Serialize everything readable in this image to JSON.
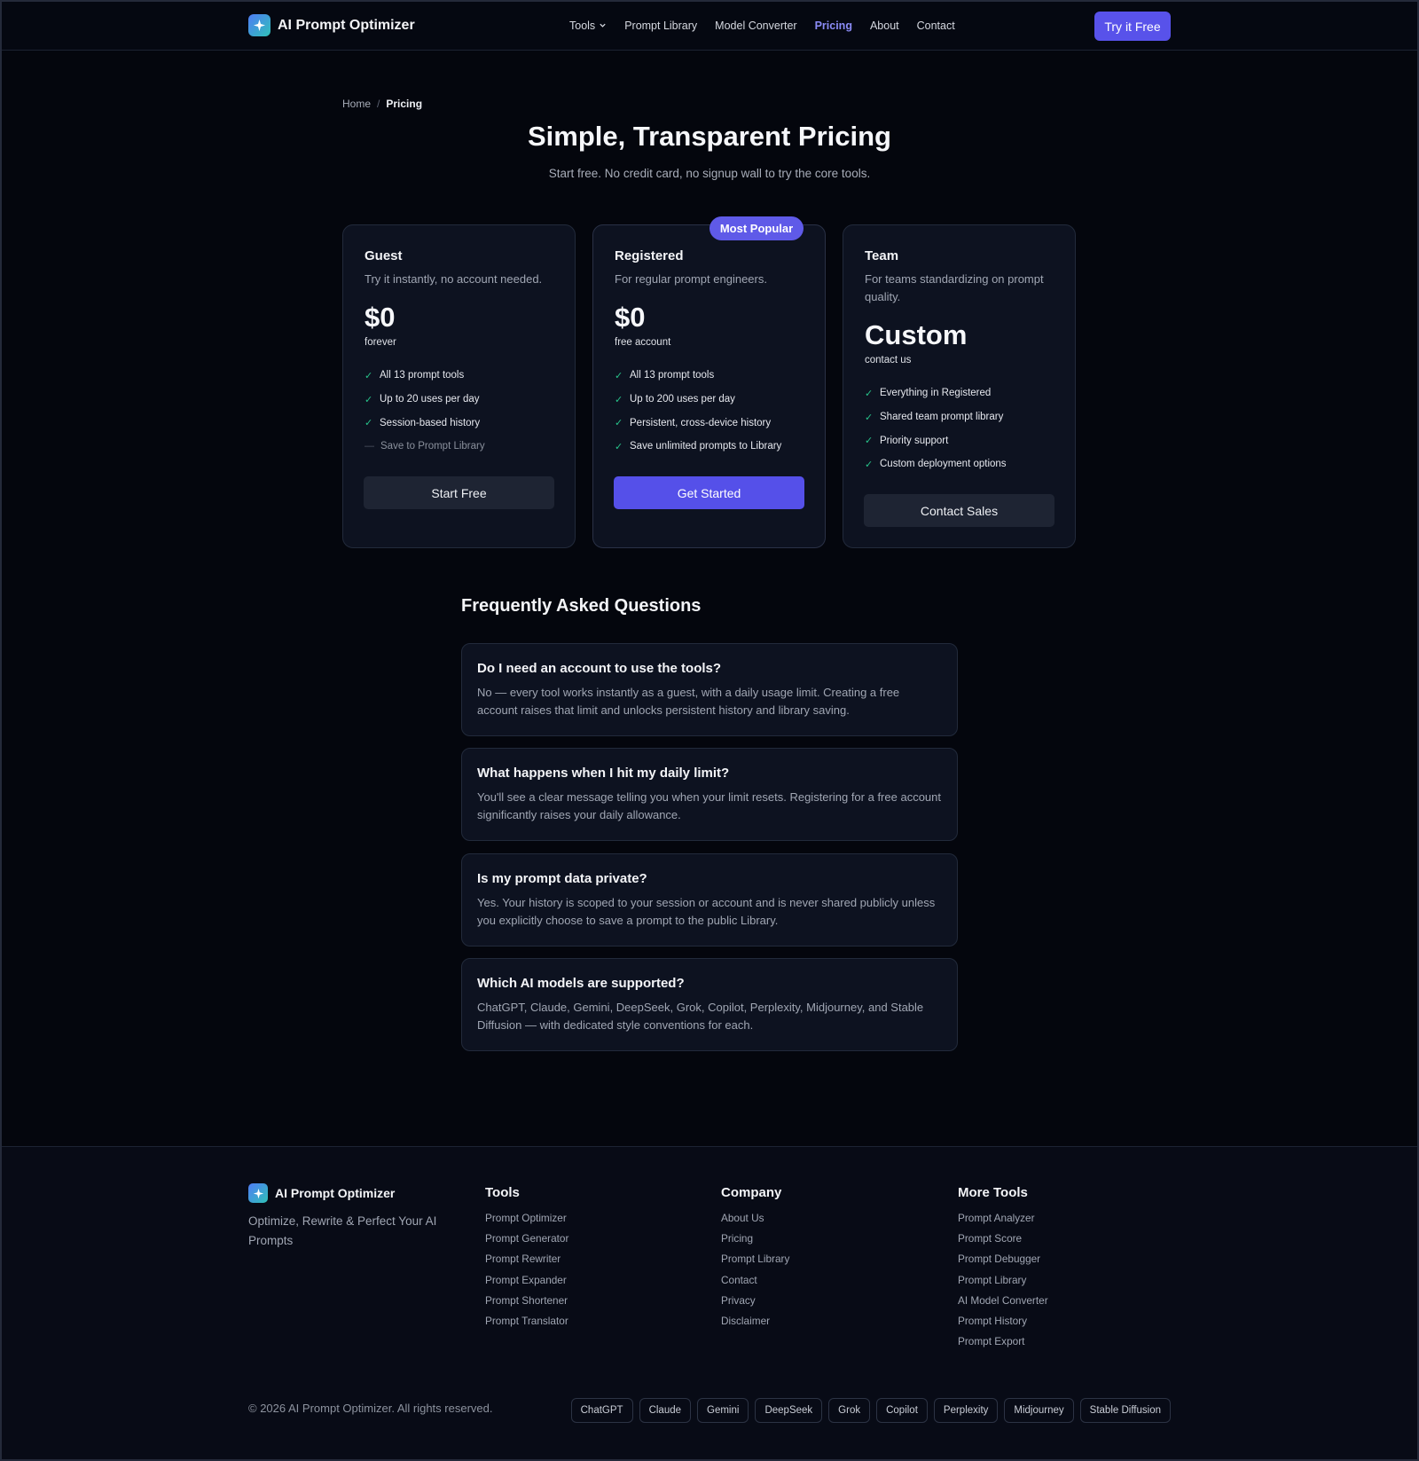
{
  "nav": {
    "brand": "AI Prompt Optimizer",
    "links": [
      {
        "label": "Tools",
        "dropdown": true,
        "active": false
      },
      {
        "label": "Prompt Library",
        "active": false
      },
      {
        "label": "Model Converter",
        "active": false
      },
      {
        "label": "Pricing",
        "active": true
      },
      {
        "label": "About",
        "active": false
      },
      {
        "label": "Contact",
        "active": false
      }
    ],
    "cta": "Try it Free",
    "accent_color": "#5852ea"
  },
  "breadcrumb": {
    "home": "Home",
    "separator": "/",
    "current": "Pricing"
  },
  "header": {
    "title": "Simple, Transparent Pricing",
    "subtitle": "Start free. No credit card, no signup wall to try the core tools."
  },
  "plans": [
    {
      "name": "Guest",
      "description": "Try it instantly, no account needed.",
      "price": "$0",
      "period": "forever",
      "features": [
        {
          "text": "All 13 prompt tools",
          "included": true
        },
        {
          "text": "Up to 20 uses per day",
          "included": true
        },
        {
          "text": "Session-based history",
          "included": true
        },
        {
          "text": "Save to Prompt Library",
          "included": false
        }
      ],
      "button": "Start Free"
    },
    {
      "name": "Registered",
      "badge": "Most Popular",
      "description": "For regular prompt engineers.",
      "price": "$0",
      "period": "free account",
      "features": [
        {
          "text": "All 13 prompt tools",
          "included": true
        },
        {
          "text": "Up to 200 uses per day",
          "included": true
        },
        {
          "text": "Persistent, cross-device history",
          "included": true
        },
        {
          "text": "Save unlimited prompts to Library",
          "included": true
        }
      ],
      "button": "Get Started"
    },
    {
      "name": "Team",
      "description": "For teams standardizing on prompt quality.",
      "price": "Custom",
      "period": "contact us",
      "features": [
        {
          "text": "Everything in Registered",
          "included": true
        },
        {
          "text": "Shared team prompt library",
          "included": true
        },
        {
          "text": "Priority support",
          "included": true
        },
        {
          "text": "Custom deployment options",
          "included": true
        }
      ],
      "button": "Contact Sales"
    }
  ],
  "faq": {
    "title": "Frequently Asked Questions",
    "items": [
      {
        "q": "Do I need an account to use the tools?",
        "a": "No — every tool works instantly as a guest, with a daily usage limit. Creating a free account raises that limit and unlocks persistent history and library saving."
      },
      {
        "q": "What happens when I hit my daily limit?",
        "a": "You'll see a clear message telling you when your limit resets. Registering for a free account significantly raises your daily allowance."
      },
      {
        "q": "Is my prompt data private?",
        "a": "Yes. Your history is scoped to your session or account and is never shared publicly unless you explicitly choose to save a prompt to the public Library."
      },
      {
        "q": "Which AI models are supported?",
        "a": "ChatGPT, Claude, Gemini, DeepSeek, Grok, Copilot, Perplexity, Midjourney, and Stable Diffusion — with dedicated style conventions for each."
      }
    ]
  },
  "footer": {
    "brand": "AI Prompt Optimizer",
    "tagline": "Optimize, Rewrite & Perfect Your AI Prompts",
    "columns": [
      {
        "title": "Tools",
        "links": [
          "Prompt Optimizer",
          "Prompt Generator",
          "Prompt Rewriter",
          "Prompt Expander",
          "Prompt Shortener",
          "Prompt Translator"
        ]
      },
      {
        "title": "Company",
        "links": [
          "About Us",
          "Pricing",
          "Prompt Library",
          "Contact",
          "Privacy",
          "Disclaimer"
        ]
      },
      {
        "title": "More Tools",
        "links": [
          "Prompt Analyzer",
          "Prompt Score",
          "Prompt Debugger",
          "Prompt Library",
          "AI Model Converter",
          "Prompt History",
          "Prompt Export"
        ]
      }
    ],
    "copyright": "© 2026 AI Prompt Optimizer. All rights reserved.",
    "model_chips": [
      "ChatGPT",
      "Claude",
      "Gemini",
      "DeepSeek",
      "Grok",
      "Copilot",
      "Perplexity",
      "Midjourney",
      "Stable Diffusion"
    ]
  }
}
